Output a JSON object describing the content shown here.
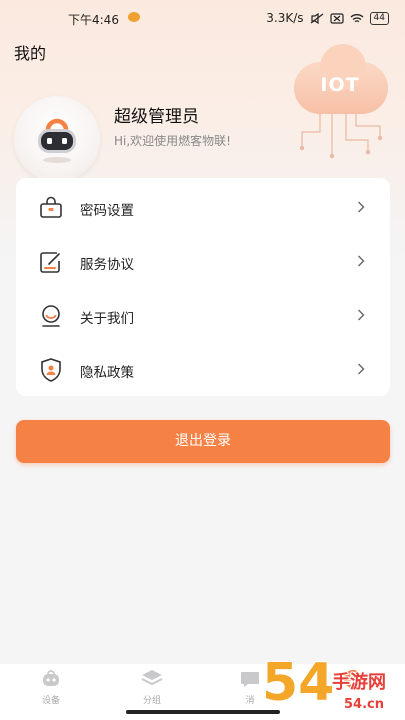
{
  "status_bar": {
    "time": "下午4:46",
    "network_speed": "3.3K/s",
    "battery": "44"
  },
  "page": {
    "title": "我的"
  },
  "banner": {
    "iot_label": "IOT"
  },
  "profile": {
    "name": "超级管理员",
    "greeting": "Hi,欢迎使用燃客物联!"
  },
  "menu": {
    "items": [
      {
        "label": "密码设置",
        "icon": "lock-icon"
      },
      {
        "label": "服务协议",
        "icon": "document-edit-icon"
      },
      {
        "label": "关于我们",
        "icon": "info-icon"
      },
      {
        "label": "隐私政策",
        "icon": "shield-icon"
      }
    ]
  },
  "actions": {
    "logout_label": "退出登录"
  },
  "bottom_nav": {
    "items": [
      {
        "label": "设备",
        "icon": "device-icon"
      },
      {
        "label": "分组",
        "icon": "layers-icon"
      },
      {
        "label": "消",
        "icon": "message-icon"
      },
      {
        "label": "",
        "icon": "profile-icon"
      }
    ]
  },
  "watermark": {
    "text": "54手游网",
    "sub": "54.cn"
  },
  "colors": {
    "accent": "#f68145",
    "background": "#f5f5f6",
    "header_gradient": "#fbe9df"
  }
}
